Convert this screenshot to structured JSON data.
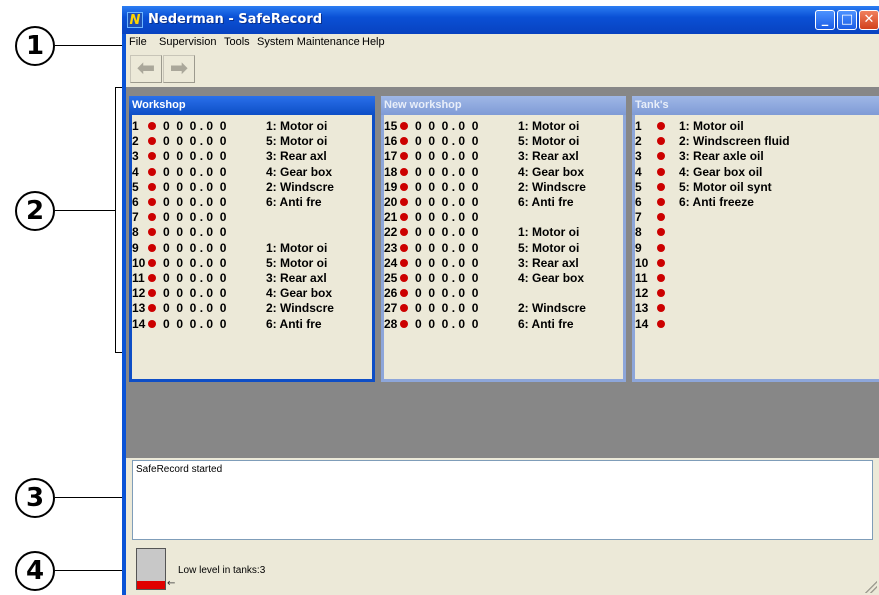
{
  "callouts": [
    "1",
    "2",
    "3",
    "4"
  ],
  "window": {
    "title": "Nederman - SafeRecord",
    "icon_letter": "N",
    "controls": {
      "minimize": "_",
      "maximize": "□",
      "close": "✕"
    }
  },
  "menu": [
    "File",
    "Supervision",
    "Tools",
    "System Maintenance",
    "Help"
  ],
  "toolbar": {
    "back_icon": "⬅",
    "forward_icon": "➡"
  },
  "panels": [
    {
      "title": "Workshop",
      "active": true,
      "rows": [
        {
          "num": "1",
          "values": "0  0  0 . 0  0",
          "label": "1: Motor oi"
        },
        {
          "num": "2",
          "values": "0  0  0 . 0  0",
          "label": "5: Motor oi"
        },
        {
          "num": "3",
          "values": "0  0  0 . 0  0",
          "label": "3: Rear axl"
        },
        {
          "num": "4",
          "values": "0  0  0 . 0  0",
          "label": "4: Gear box"
        },
        {
          "num": "5",
          "values": "0  0  0 . 0  0",
          "label": "2: Windscre"
        },
        {
          "num": "6",
          "values": "0  0  0 . 0  0",
          "label": "6: Anti fre"
        },
        {
          "num": "7",
          "values": "0  0  0 . 0  0",
          "label": ""
        },
        {
          "num": "8",
          "values": "0  0  0 . 0  0",
          "label": ""
        },
        {
          "num": "9",
          "values": "0  0  0 . 0  0",
          "label": "1: Motor oi"
        },
        {
          "num": "10",
          "values": "0  0  0 . 0  0",
          "label": "5: Motor oi"
        },
        {
          "num": "11",
          "values": "0  0  0 . 0  0",
          "label": "3: Rear axl"
        },
        {
          "num": "12",
          "values": "0  0  0 . 0  0",
          "label": "4: Gear box"
        },
        {
          "num": "13",
          "values": "0  0  0 . 0  0",
          "label": "2: Windscre"
        },
        {
          "num": "14",
          "values": "0  0  0 . 0  0",
          "label": "6: Anti fre"
        }
      ]
    },
    {
      "title": "New workshop",
      "active": false,
      "rows": [
        {
          "num": "15",
          "values": "0  0  0 . 0  0",
          "label": "1: Motor oi"
        },
        {
          "num": "16",
          "values": "0  0  0 . 0  0",
          "label": "5: Motor oi"
        },
        {
          "num": "17",
          "values": "0  0  0 . 0  0",
          "label": "3: Rear axl"
        },
        {
          "num": "18",
          "values": "0  0  0 . 0  0",
          "label": "4: Gear box"
        },
        {
          "num": "19",
          "values": "0  0  0 . 0  0",
          "label": "2: Windscre"
        },
        {
          "num": "20",
          "values": "0  0  0 . 0  0",
          "label": "6: Anti fre"
        },
        {
          "num": "21",
          "values": "0  0  0 . 0  0",
          "label": ""
        },
        {
          "num": "22",
          "values": "0  0  0 . 0  0",
          "label": "1: Motor oi"
        },
        {
          "num": "23",
          "values": "0  0  0 . 0  0",
          "label": "5: Motor oi"
        },
        {
          "num": "24",
          "values": "0  0  0 . 0  0",
          "label": "3: Rear axl"
        },
        {
          "num": "25",
          "values": "0  0  0 . 0  0",
          "label": "4: Gear box"
        },
        {
          "num": "26",
          "values": "0  0  0 . 0  0",
          "label": ""
        },
        {
          "num": "27",
          "values": "0  0  0 . 0  0",
          "label": "2: Windscre"
        },
        {
          "num": "28",
          "values": "0  0  0 . 0  0",
          "label": "6: Anti fre"
        }
      ]
    },
    {
      "title": "Tank's",
      "active": false,
      "rows": [
        {
          "num": "1",
          "values": "",
          "label": "1: Motor oil"
        },
        {
          "num": "2",
          "values": "",
          "label": "2: Windscreen fluid"
        },
        {
          "num": "3",
          "values": "",
          "label": "3: Rear axle oil"
        },
        {
          "num": "4",
          "values": "",
          "label": "4: Gear box oil"
        },
        {
          "num": "5",
          "values": "",
          "label": "5: Motor oil synt"
        },
        {
          "num": "6",
          "values": "",
          "label": "6: Anti freeze"
        },
        {
          "num": "7",
          "values": "",
          "label": ""
        },
        {
          "num": "8",
          "values": "",
          "label": ""
        },
        {
          "num": "9",
          "values": "",
          "label": ""
        },
        {
          "num": "10",
          "values": "",
          "label": ""
        },
        {
          "num": "11",
          "values": "",
          "label": ""
        },
        {
          "num": "12",
          "values": "",
          "label": ""
        },
        {
          "num": "13",
          "values": "",
          "label": ""
        },
        {
          "num": "14",
          "values": "",
          "label": ""
        }
      ]
    }
  ],
  "log": {
    "lines": [
      "SafeRecord started"
    ]
  },
  "status": {
    "text": "Low level in tanks:3",
    "tank_level_fraction": 0.2,
    "arrow": "←"
  },
  "colors": {
    "alarm_dot": "#cc0000",
    "title_active": "#0e4ec6",
    "mdi_background": "#878787"
  }
}
